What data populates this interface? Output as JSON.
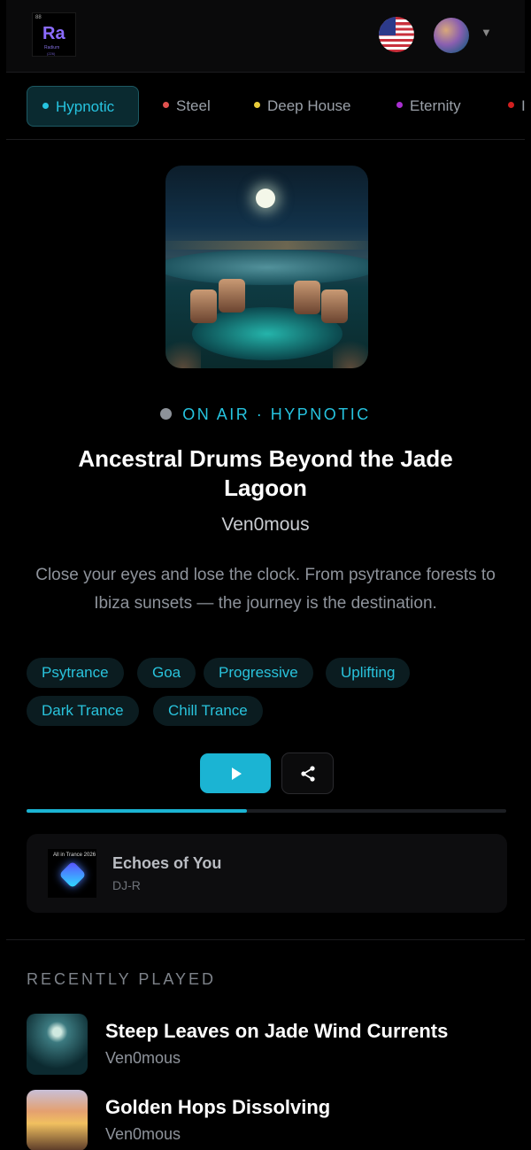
{
  "header": {
    "logo": {
      "number": "88",
      "symbol": "Ra",
      "name": "Radium",
      "mass": "(226)"
    },
    "language_icon": "us-flag-icon",
    "avatar_icon": "user-avatar",
    "menu_caret": "▼"
  },
  "stations": [
    {
      "label": "Hypnotic",
      "dot_color": "#26c4e0",
      "active": true
    },
    {
      "label": "Steel",
      "dot_color": "#e0524f",
      "active": false
    },
    {
      "label": "Deep House",
      "dot_color": "#e9cc3a",
      "active": false
    },
    {
      "label": "Eternity",
      "dot_color": "#a92fd1",
      "active": false
    },
    {
      "label": "I",
      "dot_color": "#d11f1f",
      "active": false
    }
  ],
  "now_playing": {
    "status": "ON AIR · HYPNOTIC",
    "title": "Ancestral Drums Beyond the Jade Lagoon",
    "artist": "Ven0mous",
    "description": "Close your eyes and lose the clock. From psytrance forests to Ibiza sunsets — the journey is the destination.",
    "tags": [
      "Psytrance",
      "Goa",
      "Progressive",
      "Uplifting",
      "Dark Trance",
      "Chill Trance"
    ],
    "play_icon": "play-icon",
    "share_icon": "share-icon",
    "progress": 0.46
  },
  "up_next": {
    "thumb_caption": "All in Trance 2026",
    "title": "Echoes of You",
    "artist": "DJ-R"
  },
  "recently_played": {
    "heading": "RECENTLY PLAYED",
    "items": [
      {
        "title": "Steep Leaves on Jade Wind Currents",
        "artist": "Ven0mous"
      },
      {
        "title": "Golden Hops Dissolving",
        "artist": "Ven0mous"
      }
    ]
  },
  "colors": {
    "accent": "#1bb4d3",
    "background": "#000000"
  }
}
